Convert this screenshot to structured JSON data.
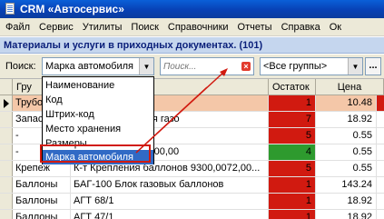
{
  "window": {
    "title": "CRM «Автосервис»",
    "icon": "document-icon"
  },
  "menu": {
    "items": [
      "Файл",
      "Сервис",
      "Утилиты",
      "Поиск",
      "Справочники",
      "Отчеты",
      "Справка",
      "Ок"
    ]
  },
  "section": {
    "title": "Материалы и услуги в приходных документах. (101)"
  },
  "toolbar": {
    "search_label": "Поиск:",
    "field_combo_value": "Марка автомобиля",
    "search_placeholder": "Поиск...",
    "group_combo_value": "<Все группы>",
    "more_button": "..."
  },
  "field_dropdown": {
    "options": [
      "Наименование",
      "Код",
      "Штрих-код",
      "Место хранения",
      "Размеры",
      "Марка автомобиля"
    ],
    "highlighted_index": 5
  },
  "grid": {
    "columns": {
      "group": "Гру",
      "name": "Наименование",
      "stock": "Остаток",
      "price": "Цена"
    },
    "rows": [
      {
        "group": "Трубо",
        "name": "",
        "stock": "1",
        "price": "10.48",
        "stock_color": "red",
        "selected": true
      },
      {
        "group": "Запас",
        "name": "улятора давления газо",
        "stock": "7",
        "price": "18.92",
        "stock_color": "red",
        "selected": false
      },
      {
        "group": "-",
        "name": "ЛИУ 290,00,00",
        "stock": "5",
        "price": "0.55",
        "stock_color": "red",
        "selected": false
      },
      {
        "group": "-",
        "name": "290,00 ГЛИУ 291,00,00",
        "stock": "4",
        "price": "0.55",
        "stock_color": "green",
        "selected": false
      },
      {
        "group": "Крепеж",
        "name": "К-т Крепления баллонов 9300,0072,00...",
        "stock": "5",
        "price": "0.55",
        "stock_color": "red",
        "selected": false
      },
      {
        "group": "Баллоны",
        "name": "БАГ-100 Блок газовых баллонов",
        "stock": "1",
        "price": "143.24",
        "stock_color": "red",
        "selected": false
      },
      {
        "group": "Баллоны",
        "name": "АГТ 68/1",
        "stock": "1",
        "price": "18.92",
        "stock_color": "red",
        "selected": false
      },
      {
        "group": "Баллоны",
        "name": "АГТ 47/1",
        "stock": "1",
        "price": "18.92",
        "stock_color": "red",
        "selected": false
      }
    ]
  },
  "colors": {
    "title_bar": "#0841b5",
    "section_header_bg": "#c5d6ee",
    "section_header_text": "#0a1f7a",
    "selected_row": "#f4c7a8",
    "stock_red": "#d11a10",
    "stock_green": "#2e9a2e",
    "dropdown_highlight": "#316ac5",
    "annotation": "#d11a10"
  }
}
